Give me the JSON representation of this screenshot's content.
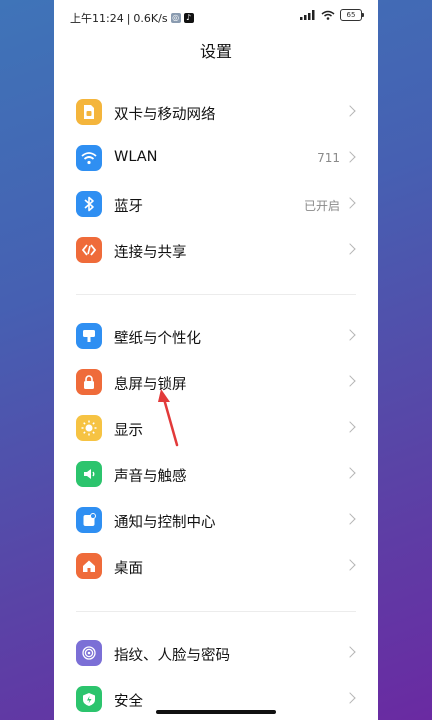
{
  "status_bar": {
    "time": "上午11:24",
    "speed": "0.6K/s",
    "battery": "65"
  },
  "page_title": "设置",
  "colors": {
    "sim": "#f4b53c",
    "wlan": "#2f8ff2",
    "bluetooth": "#2f8ff2",
    "share": "#ef6b3a",
    "wallpaper": "#2f8ff2",
    "lockscreen": "#ef6b3a",
    "display": "#f6c343",
    "sound": "#2cc46d",
    "notify": "#2f8ff2",
    "desktop": "#ef6b3a",
    "fingerprint": "#7b6fd6",
    "security": "#2cc46d",
    "arrow": "#e23a3a"
  },
  "groups": [
    {
      "items": [
        {
          "label": "双卡与移动网络",
          "value": "",
          "icon": "sim-card-icon"
        },
        {
          "label": "WLAN",
          "value": "711",
          "icon": "wifi-icon"
        },
        {
          "label": "蓝牙",
          "value": "已开启",
          "icon": "bluetooth-icon"
        },
        {
          "label": "连接与共享",
          "value": "",
          "icon": "share-icon"
        }
      ]
    },
    {
      "items": [
        {
          "label": "壁纸与个性化",
          "value": "",
          "icon": "wallpaper-icon"
        },
        {
          "label": "息屏与锁屏",
          "value": "",
          "icon": "lock-icon"
        },
        {
          "label": "显示",
          "value": "",
          "icon": "sun-icon"
        },
        {
          "label": "声音与触感",
          "value": "",
          "icon": "speaker-icon"
        },
        {
          "label": "通知与控制中心",
          "value": "",
          "icon": "notification-icon"
        },
        {
          "label": "桌面",
          "value": "",
          "icon": "home-icon"
        }
      ]
    },
    {
      "items": [
        {
          "label": "指纹、人脸与密码",
          "value": "",
          "icon": "fingerprint-icon"
        },
        {
          "label": "安全",
          "value": "",
          "icon": "shield-icon"
        }
      ]
    }
  ]
}
